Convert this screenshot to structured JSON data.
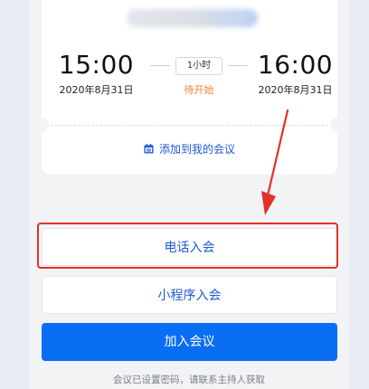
{
  "meeting": {
    "start_time": "15:00",
    "start_date": "2020年8月31日",
    "end_time": "16:00",
    "end_date": "2020年8月31日",
    "duration": "1小时",
    "status": "待开始"
  },
  "actions": {
    "add_to_calendar": "添加到我的会议",
    "phone_join": "电话入会",
    "mini_program_join": "小程序入会",
    "join_meeting": "加入会议"
  },
  "footer": {
    "hint": "会议已设置密码，请联系主持人获取"
  },
  "colors": {
    "accent": "#0a6ef5",
    "link": "#1e5ad8",
    "status": "#ff7d2e",
    "highlight": "#e0312b"
  }
}
